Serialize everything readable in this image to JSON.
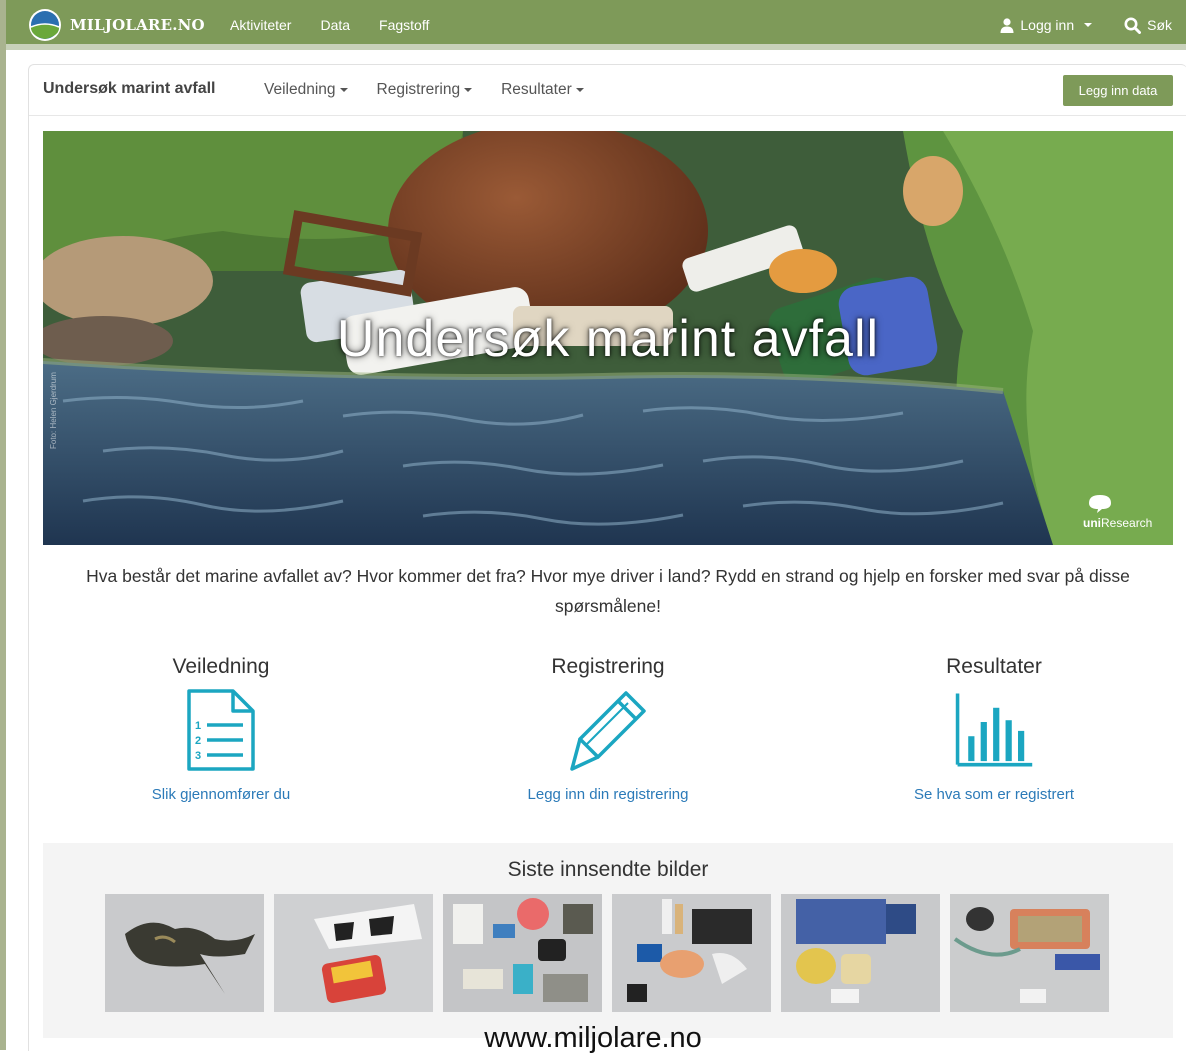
{
  "site": {
    "brand": "MILJOLARE.NO",
    "nav": [
      "Aktiviteter",
      "Data",
      "Fagstoff"
    ],
    "login": "Logg inn",
    "search": "Søk"
  },
  "subnav": {
    "title": "Undersøk marint avfall",
    "links": [
      "Veiledning",
      "Registrering",
      "Resultater"
    ],
    "cta": "Legg inn data"
  },
  "hero": {
    "title": "Undersøk marint avfall",
    "credit": "Foto: Helen Gjerdrum",
    "sponsor_prefix": "uni",
    "sponsor_suffix": "Research"
  },
  "intro": "Hva består det marine avfallet av? Hvor kommer det fra? Hvor mye driver i land? Rydd en strand og hjelp en forsker med svar på disse spørsmålene!",
  "features": [
    {
      "title": "Veiledning",
      "link": "Slik gjennomfører du",
      "icon": "list-document-icon"
    },
    {
      "title": "Registrering",
      "link": "Legg inn din registrering",
      "icon": "pencil-icon"
    },
    {
      "title": "Resultater",
      "link": "Se hva som er registrert",
      "icon": "bar-chart-icon"
    }
  ],
  "gallery": {
    "title": "Siste innsendte bilder",
    "image_count": 6
  },
  "footer_url": "www.miljolare.no",
  "colors": {
    "brand_green": "#7e9a59",
    "link_blue": "#2b7ab8",
    "icon_teal": "#1ba6c1"
  }
}
